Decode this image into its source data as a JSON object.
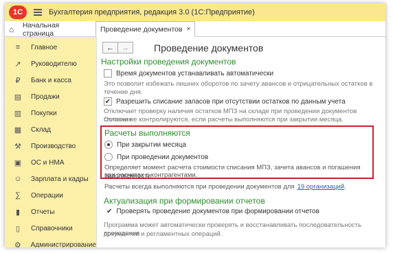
{
  "app": {
    "logo_text": "1С",
    "title": "Бухгалтерия предприятия, редакция 3.0  (1С:Предприятие)"
  },
  "tabs": [
    {
      "label": "Начальная страница"
    },
    {
      "label": "Проведение документов",
      "close": "×"
    }
  ],
  "sidebar": {
    "items": [
      {
        "label": "Главное",
        "icon": "menu-icon"
      },
      {
        "label": "Руководителю",
        "icon": "trend-icon"
      },
      {
        "label": "Банк и касса",
        "icon": "bank-icon"
      },
      {
        "label": "Продажи",
        "icon": "cart-icon"
      },
      {
        "label": "Покупки",
        "icon": "basket-icon"
      },
      {
        "label": "Склад",
        "icon": "warehouse-icon"
      },
      {
        "label": "Производство",
        "icon": "factory-icon"
      },
      {
        "label": "ОС и НМА",
        "icon": "assets-icon"
      },
      {
        "label": "Зарплата и кадры",
        "icon": "people-icon"
      },
      {
        "label": "Операции",
        "icon": "operations-icon"
      },
      {
        "label": "Отчеты",
        "icon": "reports-icon"
      },
      {
        "label": "Справочники",
        "icon": "books-icon"
      },
      {
        "label": "Администрирование",
        "icon": "gear-icon"
      }
    ]
  },
  "page": {
    "title": "Проведение документов",
    "nav_back": "←",
    "nav_forward": "→",
    "settings": {
      "title": "Настройки проведения документов",
      "auto_time": {
        "label": "Время документов устанавливать автоматически",
        "checked": false,
        "note": "Это позволит избежать лишних оборотов по зачету авансов и отрицательных остатков в течение дня."
      },
      "allow_writeoff": {
        "label": "Разрешить списание запасов при отсутствии остатков по данным учета",
        "checked": true,
        "note_line1": "Отключает проверку наличия остатков МПЗ на складе при проведении документов списания.",
        "note_line2": "Остатки не контролируются, если расчеты выполняются при закрытии месяца."
      }
    },
    "calculations": {
      "title": "Расчеты выполняются",
      "option_close": "При закрытии месяца",
      "option_posting": "При проведении документов",
      "selected": "При закрытии месяца",
      "note_line1": "Определяет момент расчета стоимости списания МПЗ, зачета авансов и погашения задолженности",
      "note_line2": "при расчетах с контрагентами.",
      "always_text": "Расчеты всегда выполняются при проведении документов для",
      "always_link": "19 организаций",
      "always_end": "."
    },
    "actualization": {
      "title": "Актуализация при формировании отчетов",
      "check_label": "Проверять проведение документов при формировании отчетов",
      "checked": true,
      "note_line1": "Программа может автоматически проверять и восстанавливать последовательность проведения",
      "note_line2": "документов и регламентных операций."
    }
  }
}
